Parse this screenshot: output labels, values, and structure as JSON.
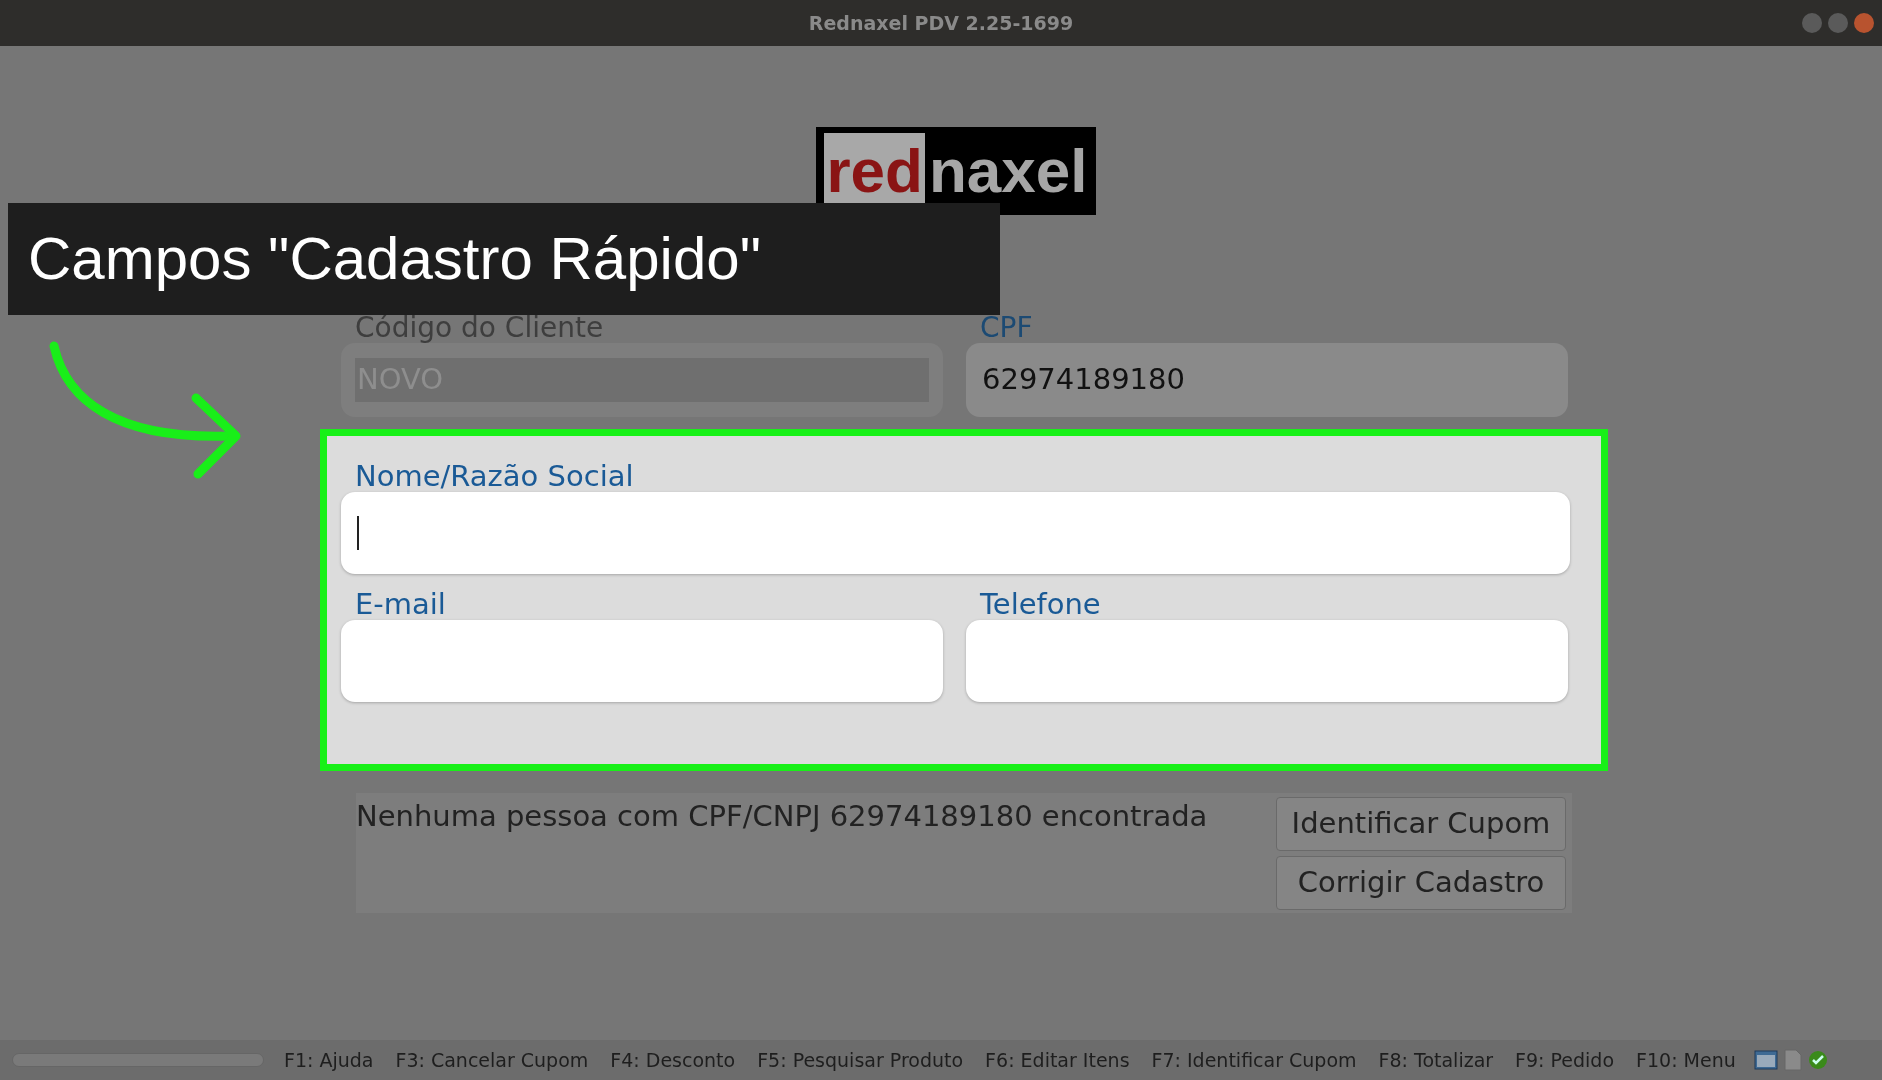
{
  "window": {
    "title": "Rednaxel PDV 2.25-1699"
  },
  "logo": {
    "part_1": "red",
    "part_2": "naxel"
  },
  "caption": {
    "text": "Campos \"Cadastro Rápido\""
  },
  "top_fields": [
    {
      "label": "Código do Cliente",
      "value": "NOVO",
      "disabled": true
    },
    {
      "label": "CPF",
      "value": "62974189180",
      "disabled": false
    }
  ],
  "quick_register": {
    "highlighted": true,
    "name_field": {
      "label": "Nome/Razão Social",
      "focused": true
    },
    "fields": [
      {
        "label": "E-mail",
        "focused": false
      },
      {
        "label": "Telefone",
        "focused": false
      }
    ]
  },
  "message": "Nenhuma pessoa com CPF/CNPJ 62974189180 encontrada",
  "buttons": [
    "Identificar Cupom",
    "Corrigir Cadastro"
  ],
  "status_bar": {
    "progress": {
      "level": 0
    },
    "shortcuts": [
      "F1: Ajuda",
      "F3: Cancelar Cupom",
      "F4: Desconto",
      "F5: Pesquisar Produto",
      "F6: Editar Itens",
      "F7: Identificar Cupom",
      "F8: Totalizar",
      "F9: Pedido",
      "F10: Menu"
    ]
  }
}
